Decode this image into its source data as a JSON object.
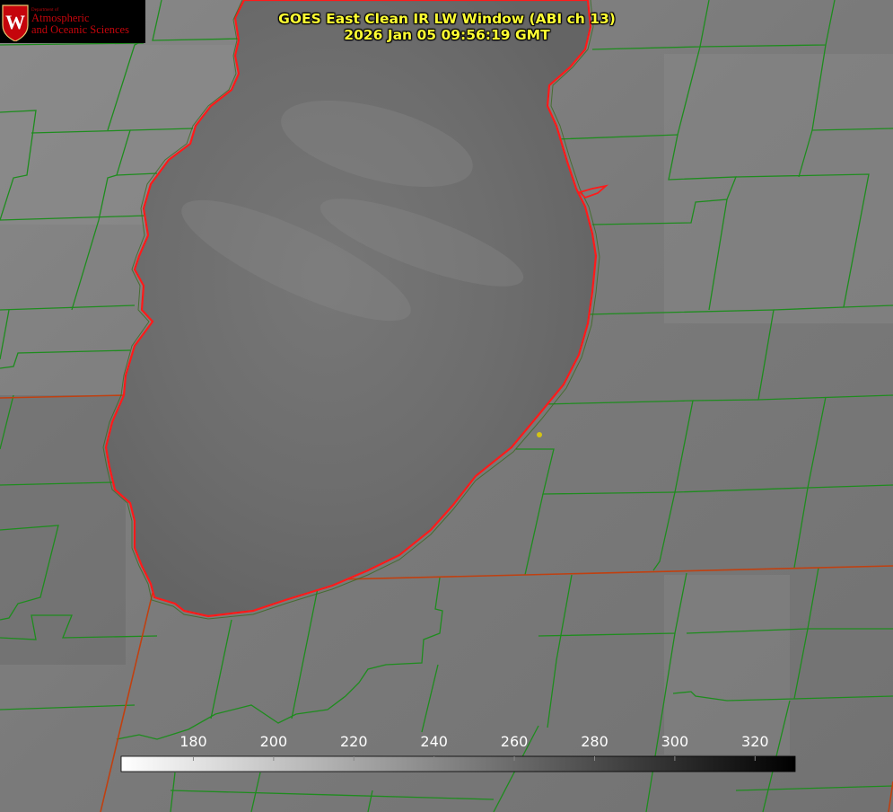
{
  "logo": {
    "department": "Department of",
    "line1": "Atmospheric",
    "line2": "and Oceanic Sciences",
    "seal_letter": "W"
  },
  "title": {
    "line1": "GOES East Clean IR LW Window (ABI ch 13)",
    "line2": "2026 Jan 05 09:56:19 GMT"
  },
  "colorbar": {
    "min": 162,
    "max": 330,
    "ticks": [
      180,
      200,
      220,
      240,
      260,
      280,
      300,
      320
    ],
    "gradient_start": "#ffffff",
    "gradient_end": "#000000"
  },
  "colors": {
    "lake_outline": "#ff1a1a",
    "county_lines": "#1e8c1e",
    "state_line": "#c04010",
    "marker": "#d4c414",
    "title_text": "#ffff33",
    "logo_text": "#c5050c"
  }
}
